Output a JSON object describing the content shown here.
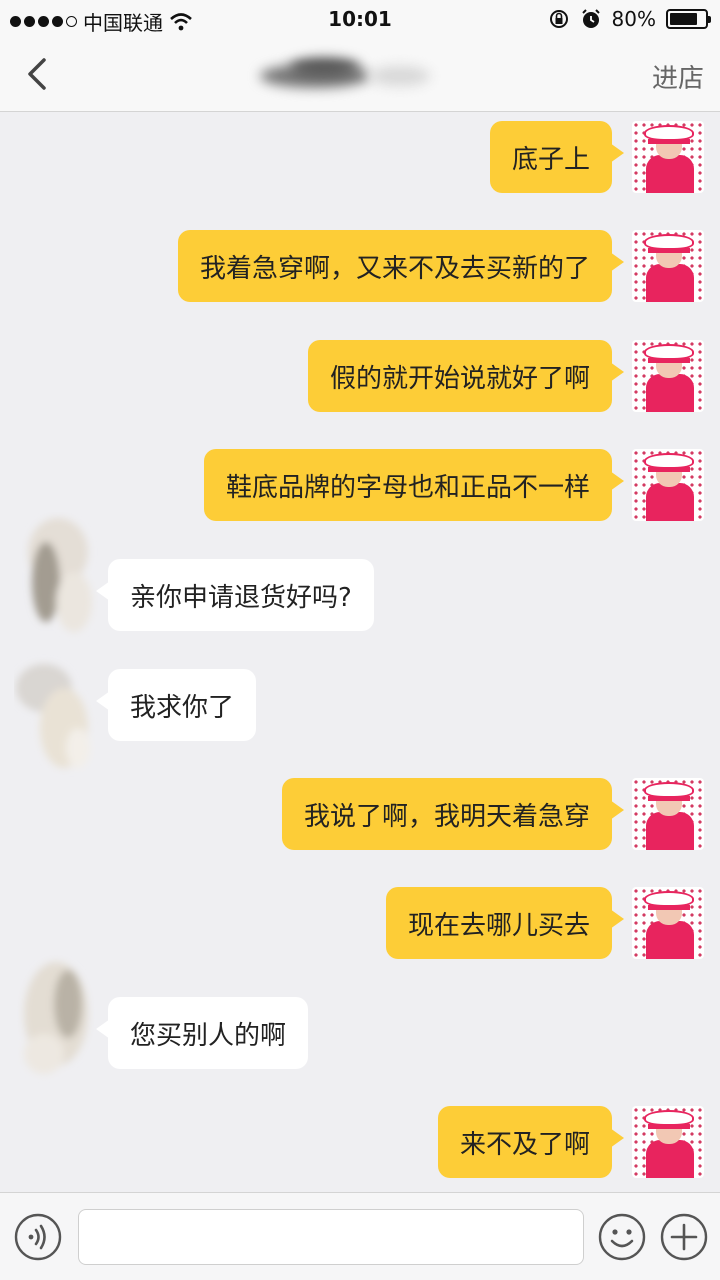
{
  "status_bar": {
    "carrier": "中国联通",
    "time": "10:01",
    "battery": "80%",
    "battery_level": 0.8
  },
  "nav": {
    "action_label": "进店",
    "back_icon": "chevron-left-icon"
  },
  "messages": [
    {
      "side": "me",
      "text": "底子上"
    },
    {
      "side": "me",
      "text": "我着急穿啊，又来不及去买新的了"
    },
    {
      "side": "me",
      "text": "假的就开始说就好了啊"
    },
    {
      "side": "me",
      "text": "鞋底品牌的字母也和正品不一样"
    },
    {
      "side": "them",
      "text": "亲你申请退货好吗?"
    },
    {
      "side": "them",
      "text": "我求你了"
    },
    {
      "side": "me",
      "text": "我说了啊，我明天着急穿"
    },
    {
      "side": "me",
      "text": "现在去哪儿买去"
    },
    {
      "side": "them",
      "text": "您买别人的啊"
    },
    {
      "side": "me",
      "text": "来不及了啊"
    }
  ],
  "input_bar": {
    "voice_icon": "voice-icon",
    "emoji_icon": "emoji-icon",
    "plus_icon": "plus-icon",
    "value": ""
  },
  "colors": {
    "my_bubble": "#fdcd37",
    "their_bubble": "#ffffff",
    "background": "#efeff2"
  }
}
